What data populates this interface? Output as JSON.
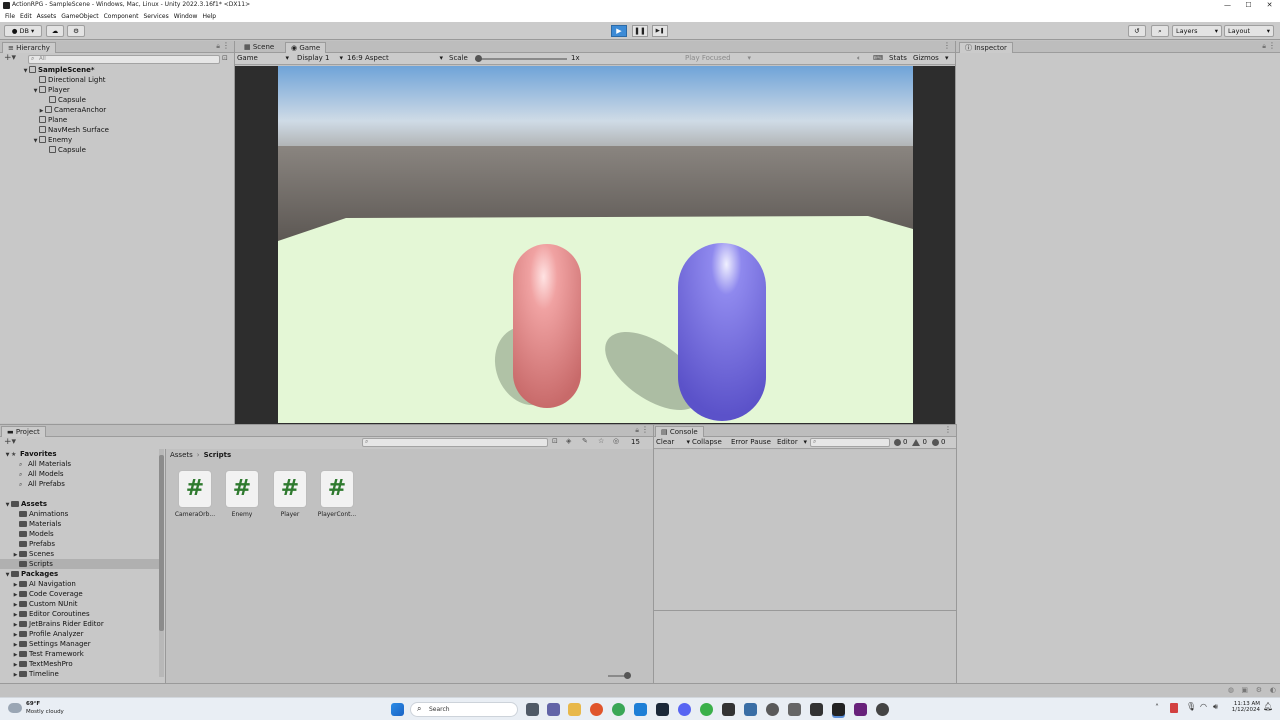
{
  "window": {
    "title": "ActionRPG - SampleScene - Windows, Mac, Linux - Unity 2022.3.16f1* <DX11>",
    "controls": [
      "—",
      "☐",
      "✕"
    ]
  },
  "menu": [
    "File",
    "Edit",
    "Assets",
    "GameObject",
    "Component",
    "Services",
    "Window",
    "Help"
  ],
  "toolbar": {
    "account": "DB",
    "layers": "Layers",
    "layout": "Layout",
    "play_icon": "▶",
    "pause_icon": "❚❚",
    "step_icon": "▶❚"
  },
  "hierarchy": {
    "tab": "Hierarchy",
    "search_placeholder": "All",
    "items": [
      {
        "label": "SampleScene*",
        "arrow": "▼",
        "icon": "scene-icon"
      },
      {
        "label": "Directional Light",
        "arrow": "",
        "icon": "gameobject-icon"
      },
      {
        "label": "Player",
        "arrow": "▼",
        "icon": "gameobject-icon"
      },
      {
        "label": "Capsule",
        "arrow": "",
        "icon": "gameobject-icon"
      },
      {
        "label": "CameraAnchor",
        "arrow": "▶",
        "icon": "gameobject-icon"
      },
      {
        "label": "Plane",
        "arrow": "",
        "icon": "gameobject-icon"
      },
      {
        "label": "NavMesh Surface",
        "arrow": "",
        "icon": "gameobject-icon"
      },
      {
        "label": "Enemy",
        "arrow": "▼",
        "icon": "gameobject-icon"
      },
      {
        "label": "Capsule",
        "arrow": "",
        "icon": "gameobject-icon"
      }
    ]
  },
  "center_tabs": {
    "scene": "Scene",
    "game": "Game"
  },
  "game_toolbar": {
    "mode": "Game",
    "display": "Display 1",
    "aspect": "16:9 Aspect",
    "scale_label": "Scale",
    "scale_value": "1x",
    "scale_fraction": 0.0,
    "play_focused": "Play Focused",
    "stats": "Stats",
    "gizmos": "Gizmos"
  },
  "inspector": {
    "tab": "Inspector"
  },
  "project": {
    "tab": "Project",
    "badge_count": "15",
    "breadcrumb": [
      "Assets",
      "Scripts"
    ],
    "tree": [
      {
        "label": "Favorites",
        "arrow": "▼",
        "icon": "star",
        "bold": true
      },
      {
        "label": "All Materials",
        "arrow": "",
        "icon": "search"
      },
      {
        "label": "All Models",
        "arrow": "",
        "icon": "search"
      },
      {
        "label": "All Prefabs",
        "arrow": "",
        "icon": "search"
      },
      {
        "label": "",
        "arrow": "",
        "icon": "none"
      },
      {
        "label": "Assets",
        "arrow": "▼",
        "icon": "folder",
        "bold": true
      },
      {
        "label": "Animations",
        "arrow": "",
        "icon": "folder"
      },
      {
        "label": "Materials",
        "arrow": "",
        "icon": "folder"
      },
      {
        "label": "Models",
        "arrow": "",
        "icon": "folder"
      },
      {
        "label": "Prefabs",
        "arrow": "",
        "icon": "folder"
      },
      {
        "label": "Scenes",
        "arrow": "▶",
        "icon": "folder"
      },
      {
        "label": "Scripts",
        "arrow": "",
        "icon": "folder",
        "selected": true
      },
      {
        "label": "Packages",
        "arrow": "▼",
        "icon": "folder",
        "bold": true
      },
      {
        "label": "AI Navigation",
        "arrow": "▶",
        "icon": "folder"
      },
      {
        "label": "Code Coverage",
        "arrow": "▶",
        "icon": "folder"
      },
      {
        "label": "Custom NUnit",
        "arrow": "▶",
        "icon": "folder"
      },
      {
        "label": "Editor Coroutines",
        "arrow": "▶",
        "icon": "folder"
      },
      {
        "label": "JetBrains Rider Editor",
        "arrow": "▶",
        "icon": "folder"
      },
      {
        "label": "Profile Analyzer",
        "arrow": "▶",
        "icon": "folder"
      },
      {
        "label": "Settings Manager",
        "arrow": "▶",
        "icon": "folder"
      },
      {
        "label": "Test Framework",
        "arrow": "▶",
        "icon": "folder"
      },
      {
        "label": "TextMeshPro",
        "arrow": "▶",
        "icon": "folder"
      },
      {
        "label": "Timeline",
        "arrow": "▶",
        "icon": "folder"
      }
    ],
    "assets": [
      {
        "label": "CameraOrb...",
        "glyph": "#"
      },
      {
        "label": "Enemy",
        "glyph": "#"
      },
      {
        "label": "Player",
        "glyph": "#"
      },
      {
        "label": "PlayerCont...",
        "glyph": "#"
      }
    ]
  },
  "console": {
    "tab": "Console",
    "clear": "Clear",
    "collapse": "Collapse",
    "error_pause": "Error Pause",
    "editor": "Editor",
    "counts": [
      "0",
      "0",
      "0"
    ]
  },
  "taskbar": {
    "weather_temp": "69°F",
    "weather_desc": "Mostly cloudy",
    "search": "Search",
    "time": "11:13 AM",
    "date": "1/12/2024"
  },
  "colors": {
    "play_active": "#3d8bd6",
    "capsule_player": "#e07c7c",
    "capsule_enemy": "#6b63d8",
    "ground": "#e6f8d8",
    "script_hash": "#2f7a2f"
  }
}
